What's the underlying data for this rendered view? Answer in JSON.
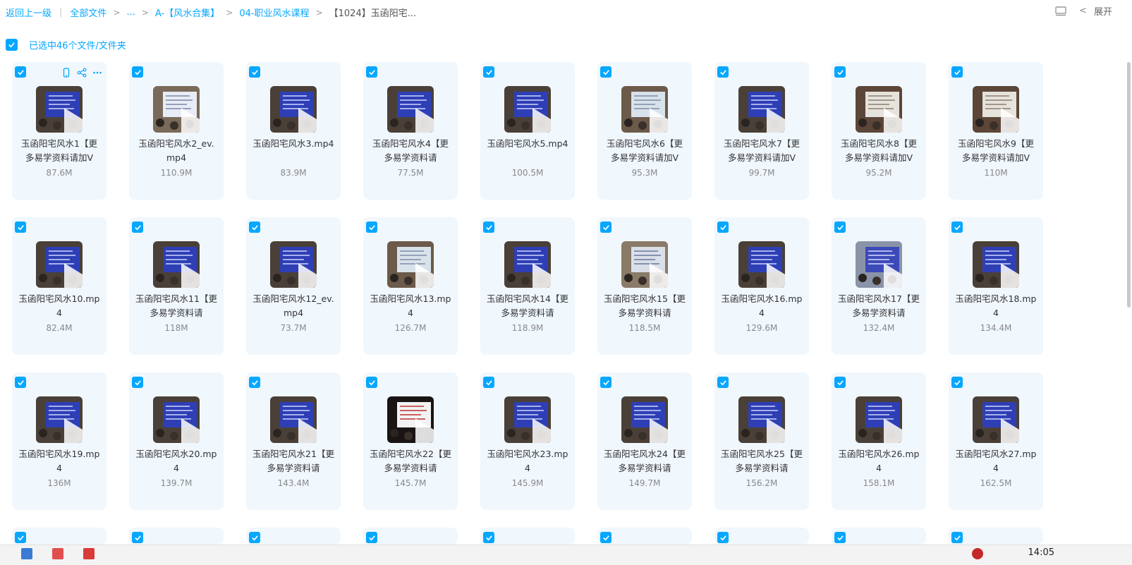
{
  "breadcrumb": {
    "back": "返回上一级",
    "items": [
      "全部文件",
      "...",
      "A-【风水合集】",
      "04-职业风水课程"
    ],
    "current": "【1024】玉函阳宅..."
  },
  "toolbar": {
    "expand_label": "展开"
  },
  "selection": {
    "text": "已选中46个文件/文件夹"
  },
  "files": [
    {
      "name": "玉函阳宅风水1【更多易学资料请加V",
      "size": "87.6M",
      "thumb": "blue"
    },
    {
      "name": "玉函阳宅风水2_ev.mp4",
      "size": "110.9M",
      "thumb": "white"
    },
    {
      "name": "玉函阳宅风水3.mp4",
      "size": "83.9M",
      "thumb": "blue"
    },
    {
      "name": "玉函阳宅风水4【更多易学资料请",
      "size": "77.5M",
      "thumb": "blue"
    },
    {
      "name": "玉函阳宅风水5.mp4",
      "size": "100.5M",
      "thumb": "blue"
    },
    {
      "name": "玉函阳宅风水6【更多易学资料请加V",
      "size": "95.3M",
      "thumb": "light"
    },
    {
      "name": "玉函阳宅风水7【更多易学资料请加V",
      "size": "99.7M",
      "thumb": "blue"
    },
    {
      "name": "玉函阳宅风水8【更多易学资料请加V",
      "size": "95.2M",
      "thumb": "board"
    },
    {
      "name": "玉函阳宅风水9【更多易学资料请加V",
      "size": "110M",
      "thumb": "board"
    },
    {
      "name": "玉函阳宅风水10.mp4",
      "size": "82.4M",
      "thumb": "blue"
    },
    {
      "name": "玉函阳宅风水11【更多易学资料请",
      "size": "118M",
      "thumb": "blue"
    },
    {
      "name": "玉函阳宅风水12_ev.mp4",
      "size": "73.7M",
      "thumb": "blue"
    },
    {
      "name": "玉函阳宅风水13.mp4",
      "size": "126.7M",
      "thumb": "light"
    },
    {
      "name": "玉函阳宅风水14【更多易学资料请",
      "size": "118.9M",
      "thumb": "blue"
    },
    {
      "name": "玉函阳宅风水15【更多易学资料请",
      "size": "118.5M",
      "thumb": "yellow"
    },
    {
      "name": "玉函阳宅风水16.mp4",
      "size": "129.6M",
      "thumb": "blue"
    },
    {
      "name": "玉函阳宅风水17【更多易学资料请",
      "size": "132.4M",
      "thumb": "room"
    },
    {
      "name": "玉函阳宅风水18.mp4",
      "size": "134.4M",
      "thumb": "blue"
    },
    {
      "name": "玉函阳宅风水19.mp4",
      "size": "136M",
      "thumb": "blue"
    },
    {
      "name": "玉函阳宅风水20.mp4",
      "size": "139.7M",
      "thumb": "blue"
    },
    {
      "name": "玉函阳宅风水21【更多易学资料请",
      "size": "143.4M",
      "thumb": "blue"
    },
    {
      "name": "玉函阳宅风水22【更多易学资料请",
      "size": "145.7M",
      "thumb": "dark"
    },
    {
      "name": "玉函阳宅风水23.mp4",
      "size": "145.9M",
      "thumb": "blue"
    },
    {
      "name": "玉函阳宅风水24【更多易学资料请",
      "size": "149.7M",
      "thumb": "blue"
    },
    {
      "name": "玉函阳宅风水25【更多易学资料请",
      "size": "156.2M",
      "thumb": "blue"
    },
    {
      "name": "玉函阳宅风水26.mp4",
      "size": "158.1M",
      "thumb": "blue"
    },
    {
      "name": "玉函阳宅风水27.mp4",
      "size": "162.5M",
      "thumb": "blue"
    }
  ],
  "taskbar": {
    "time": "14:05"
  },
  "colors": {
    "accent": "#06a7ff",
    "card_bg": "#f0f7fd"
  }
}
